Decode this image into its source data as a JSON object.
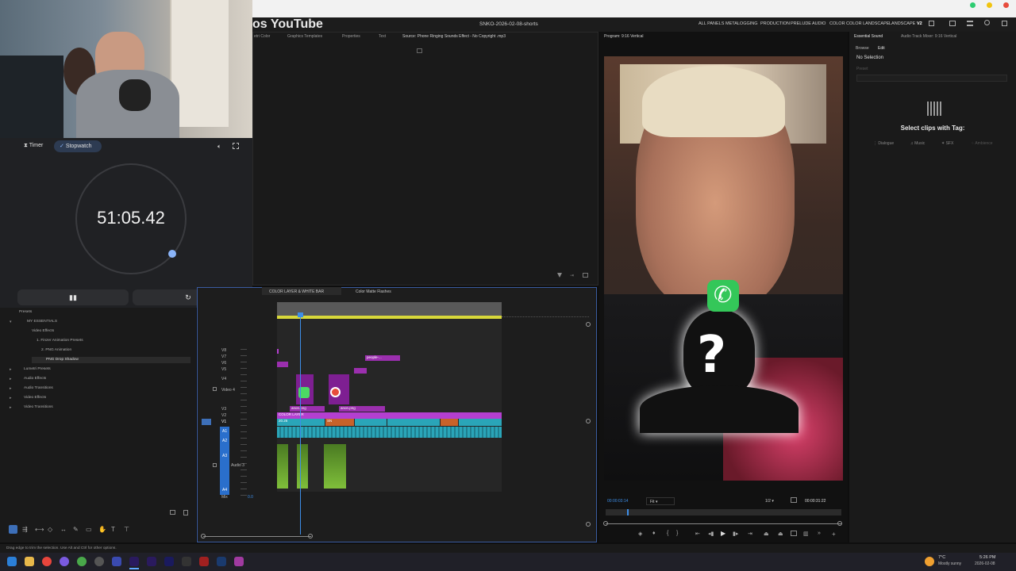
{
  "browser": {
    "controls": [
      "green",
      "yellow",
      "red"
    ]
  },
  "header": {
    "yt_title": "os YouTube",
    "project_title": "SNKO-2026-02-08-shorts",
    "workspaces": [
      "ALL PANELS",
      "METALOGGING",
      "PRODUCTION",
      "PRELUDE",
      "AUDIO",
      "COLOR",
      "COLOR LANDSCAPE",
      "LANDSCAPE",
      "V2"
    ]
  },
  "source_tabs": [
    "etri Color",
    "Graphics Templates",
    "Properties",
    "Text",
    "Source: Phone Ringing Sounds Effect - No Copyright .mp3"
  ],
  "program": {
    "title": "Program: 9:16 Vertical",
    "timecode_in": "00:00:03:14",
    "zoom": "Fit",
    "resolution": "1/2",
    "timecode_out": "00:00:31:22"
  },
  "essential": {
    "tab1": "Essential Sound",
    "tab2": "Audio Track Mixer: 9:16 Vertical",
    "browse": "Browse",
    "edit": "Edit",
    "no_selection": "No Selection",
    "preset_label": "Preset",
    "select_clips": "Select clips with Tag:",
    "tags": [
      "Dialogue",
      "Music",
      "SFX",
      "Ambience"
    ]
  },
  "timer": {
    "tab_timer": "Timer",
    "tab_stopwatch": "Stopwatch",
    "value": "51:05.42",
    "pause_icon": "pause-icon",
    "reset_icon": "reset-icon"
  },
  "effects": {
    "items": [
      {
        "label": "Presets",
        "level": 0
      },
      {
        "label": "MY ESSENTIALS",
        "level": 1
      },
      {
        "label": "Video Effects",
        "level": 2
      },
      {
        "label": "1. Finzer Animation Presets",
        "level": 3
      },
      {
        "label": "2. PNG Animation",
        "level": 4
      },
      {
        "label": "PNG Drop Shadow",
        "level": 5
      },
      {
        "label": "Lumetri Presets",
        "level": 0
      },
      {
        "label": "Audio Effects",
        "level": 0
      },
      {
        "label": "Audio Transitions",
        "level": 0
      },
      {
        "label": "Video Effects",
        "level": 0
      },
      {
        "label": "Video Transitions",
        "level": 0
      }
    ]
  },
  "timeline": {
    "tabs": [
      "COLOR LAYER & WHITE BAR",
      "Color Matte Flashes"
    ],
    "tracks": [
      "V8",
      "V7",
      "V6",
      "V5",
      "V4",
      "Video 4",
      "V3",
      "V2",
      "V1",
      "A1",
      "A2",
      "A3",
      "Audio 3",
      "A4",
      "Mix"
    ],
    "mix_value": "0.0",
    "clips": {
      "people": "people-...",
      "anon1": "anon.png",
      "anon2": "anon.png",
      "color_layer": "COLOR LAYER",
      "v1_a": "20.26",
      "v1_b": "SN"
    }
  },
  "status_bar": "Drag edge to trim the selection. Use Alt and Ctrl for other options.",
  "taskbar": {
    "weather_temp": "7°C",
    "weather_text": "Mostly sunny",
    "time": "5:26 PM",
    "date": "2026-02-08"
  },
  "colors": {
    "accent": "#3d8ee8",
    "clip_purple": "#9b2fae",
    "clip_teal": "#2aa5b8",
    "clip_orange": "#c8622a",
    "clip_green": "#5f9a2a",
    "workarea_yellow": "#d8d83a"
  }
}
